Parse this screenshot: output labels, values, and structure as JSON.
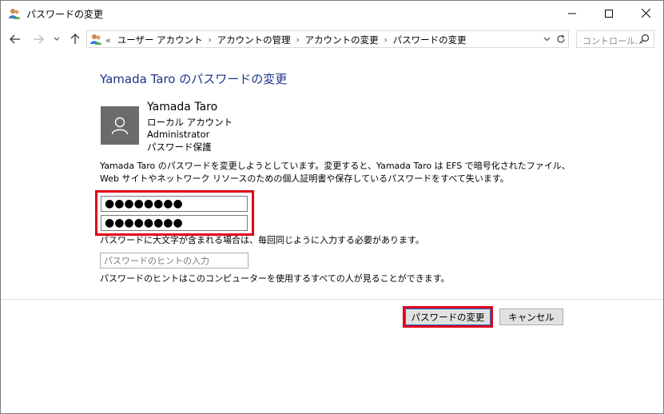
{
  "window": {
    "title": "パスワードの変更"
  },
  "address": {
    "lead": "«",
    "crumbs": [
      "ユーザー アカウント",
      "アカウントの管理",
      "アカウントの変更",
      "パスワードの変更"
    ],
    "search_placeholder": "コントロール..."
  },
  "page": {
    "title": "Yamada Taro のパスワードの変更",
    "user": {
      "name": "Yamada Taro",
      "account_type": "ローカル アカウント",
      "role": "Administrator",
      "protection": "パスワード保護"
    },
    "info": "Yamada Taro のパスワードを変更しようとしています。変更すると、Yamada Taro は EFS で暗号化されたファイル、Web サイトやネットワーク リソースのための個人証明書や保存しているパスワードをすべて失います。",
    "new_password": "●●●●●●●●",
    "confirm_password": "●●●●●●●●",
    "case_note": "パスワードに大文字が含まれる場合は、毎回同じように入力する必要があります。",
    "hint_placeholder": "パスワードのヒントの入力",
    "hint_note": "パスワードのヒントはこのコンピューターを使用するすべての人が見ることができます。"
  },
  "buttons": {
    "change": "パスワードの変更",
    "cancel": "キャンセル"
  },
  "colors": {
    "title_blue": "#1e3287",
    "highlight_red": "#e2001a",
    "avatar_gray": "#6b6b6b"
  }
}
